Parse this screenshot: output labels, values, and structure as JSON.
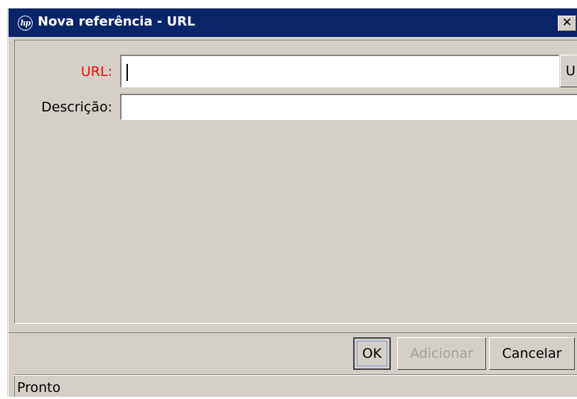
{
  "window": {
    "title": "Nova referência - URL",
    "logo_text": "hp",
    "close_glyph": "✕"
  },
  "form": {
    "url_label": "URL:",
    "url_value": "",
    "url_button_label": "U",
    "description_label": "Descrição:",
    "description_value": ""
  },
  "buttons": {
    "ok_label": "OK",
    "add_label": "Adicionar",
    "cancel_label": "Cancelar"
  },
  "status": {
    "text": "Pronto"
  },
  "colors": {
    "titlebar": "#0a246a",
    "required_label": "#ff0000",
    "window_bg": "#d4d0c8",
    "disabled_text": "#a0a0a0"
  },
  "icons": {
    "app_logo": "hp-logo-icon",
    "close": "close-icon"
  }
}
